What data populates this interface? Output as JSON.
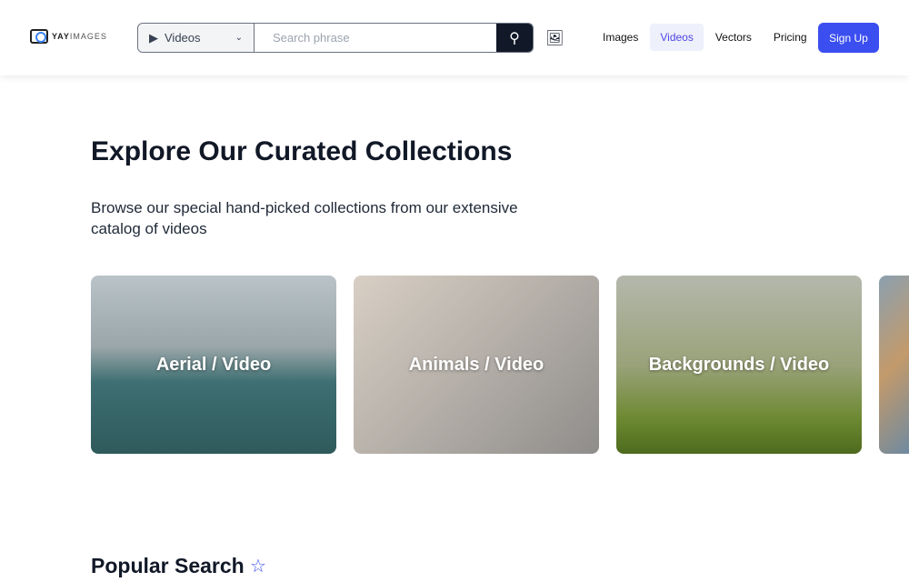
{
  "header": {
    "logo_bold": "YAY",
    "logo_rest": "IMAGES",
    "search_type": "Videos",
    "search_placeholder": "Search phrase",
    "nav": [
      {
        "label": "Images"
      },
      {
        "label": "Videos"
      },
      {
        "label": "Vectors"
      },
      {
        "label": "Pricing"
      }
    ],
    "signup": "Sign Up"
  },
  "main": {
    "title": "Explore Our Curated Collections",
    "subtitle": "Browse our special hand-picked collections from our extensive catalog of videos",
    "collections": [
      {
        "label": "Aerial / Video"
      },
      {
        "label": "Animals / Video"
      },
      {
        "label": "Backgrounds / Video"
      }
    ],
    "popular_title": "Popular Search"
  }
}
